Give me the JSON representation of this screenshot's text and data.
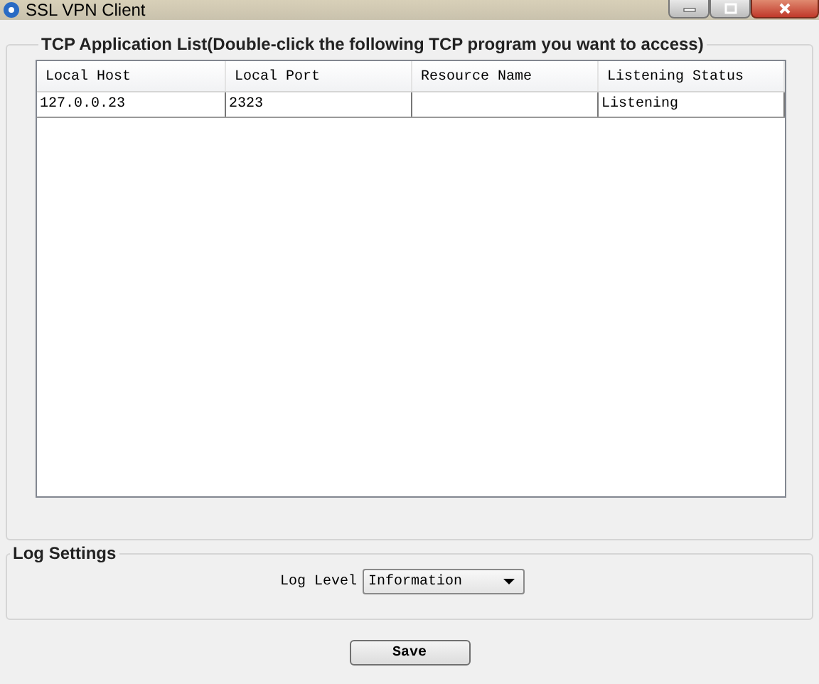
{
  "window": {
    "title": "SSL VPN Client"
  },
  "tcp_group": {
    "title": "TCP Application List(Double-click the following TCP program you want to access)",
    "table": {
      "columns": [
        "Local Host",
        "Local Port",
        "Resource Name",
        "Listening Status"
      ],
      "rows": [
        [
          "127.0.0.23",
          "2323",
          "",
          "Listening"
        ]
      ]
    }
  },
  "log_group": {
    "title": "Log Settings",
    "log_level": {
      "label": "Log Level",
      "value": "Information"
    }
  },
  "buttons": [
    "Save"
  ]
}
